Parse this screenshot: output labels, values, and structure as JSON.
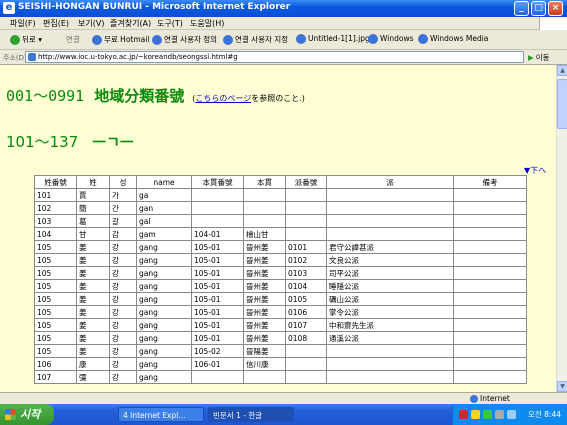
{
  "window": {
    "title": "SEISHI-HONGAN BUNRUI - Microsoft Internet Explorer"
  },
  "menu": [
    "파일(F)",
    "편집(E)",
    "보기(V)",
    "즐겨찾기(A)",
    "도구(T)",
    "도움말(H)"
  ],
  "toolbar": {
    "back_label": "뒤로",
    "links_label": "연결",
    "links": [
      "무료 Hotmail",
      "연결 사용자 정의",
      "연결 사용자 지정",
      "Untitled-1[1].jpg",
      "Windows",
      "Windows Media"
    ]
  },
  "address": {
    "label": "주소(D)",
    "url": "http://www.ioc.u-tokyo.ac.jp/~koreandb/seongssi.html#g",
    "go_label": "이동"
  },
  "page": {
    "header1_code": "001～0991",
    "header1_title": "地域分類番號",
    "header1_note_prefix": "(",
    "header1_note_link": "こちらのページ",
    "header1_note_suffix": "を参照のこと.)",
    "header2_code": "101～137",
    "header2_title": "ㅡㄱㅡ",
    "down_link": "▼下へ"
  },
  "table": {
    "headers": [
      "姓番號",
      "姓",
      "성",
      "name",
      "本貫番號",
      "本貫",
      "派番號",
      "派",
      "備考"
    ],
    "rows": [
      [
        "101",
        "賈",
        "가",
        "ga",
        "",
        "",
        "",
        "",
        ""
      ],
      [
        "102",
        "簡",
        "간",
        "gan",
        "",
        "",
        "",
        "",
        ""
      ],
      [
        "103",
        "葛",
        "갈",
        "gal",
        "",
        "",
        "",
        "",
        ""
      ],
      [
        "104",
        "甘",
        "감",
        "gam",
        "104-01",
        "檜山甘",
        "",
        "",
        ""
      ],
      [
        "105",
        "姜",
        "강",
        "gang",
        "105-01",
        "晉州姜",
        "0101",
        "君守公諱甚派",
        ""
      ],
      [
        "105",
        "姜",
        "강",
        "gang",
        "105-01",
        "晉州姜",
        "0102",
        "文良公派",
        ""
      ],
      [
        "105",
        "姜",
        "강",
        "gang",
        "105-01",
        "晉州姜",
        "0103",
        "司平公派",
        ""
      ],
      [
        "105",
        "姜",
        "강",
        "gang",
        "105-01",
        "晉州姜",
        "0104",
        "睡隱公派",
        ""
      ],
      [
        "105",
        "姜",
        "강",
        "gang",
        "105-01",
        "晉州姜",
        "0105",
        "礪山公派",
        ""
      ],
      [
        "105",
        "姜",
        "강",
        "gang",
        "105-01",
        "晉州姜",
        "0106",
        "掌令公派",
        ""
      ],
      [
        "105",
        "姜",
        "강",
        "gang",
        "105-01",
        "晉州姜",
        "0107",
        "中和齋先生派",
        ""
      ],
      [
        "105",
        "姜",
        "강",
        "gang",
        "105-01",
        "晉州姜",
        "0108",
        "通溪公派",
        ""
      ],
      [
        "105",
        "姜",
        "강",
        "gang",
        "105-02",
        "晉陽姜",
        "",
        "",
        ""
      ],
      [
        "106",
        "康",
        "강",
        "gang",
        "106-01",
        "信川康",
        "",
        "",
        ""
      ],
      [
        "107",
        "彊",
        "강",
        "gang",
        "",
        "",
        "",
        "",
        ""
      ]
    ]
  },
  "status": {
    "zone": "Internet"
  },
  "taskbar": {
    "start": "시작",
    "tasks": [
      "4 Internet Expl...",
      "빈문서 1 - 한글"
    ],
    "clock": "오전 8:44"
  }
}
